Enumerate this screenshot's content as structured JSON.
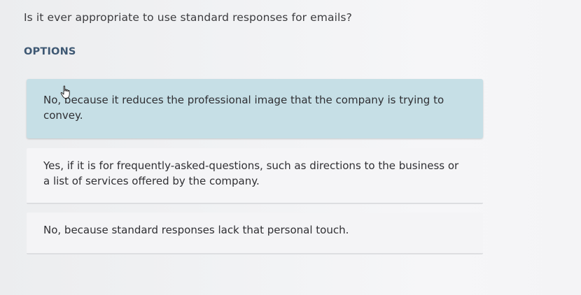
{
  "question": "Is it ever appropriate to use standard responses for emails?",
  "options_heading": "OPTIONS",
  "options": [
    {
      "text": "No, because it reduces the professional image that the company is trying to convey."
    },
    {
      "text": "Yes, if it is for frequently-asked-questions, such as directions to the business or a list of services offered by the company."
    },
    {
      "text": "No, because standard responses lack that personal touch."
    }
  ],
  "selected_option_index": 0,
  "colors": {
    "hovered_option_bg": "#c6dfe6",
    "heading": "#3e5873",
    "option_bg": "#f5f5f7"
  },
  "cursor_icon": "hand-pointer-icon"
}
